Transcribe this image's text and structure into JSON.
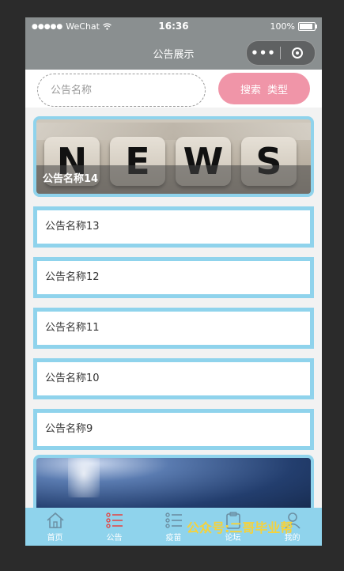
{
  "status": {
    "signal": "●●●●●",
    "carrier": "WeChat",
    "time": "16:36",
    "battery": "100%",
    "battery_level": 1.0
  },
  "navbar": {
    "title": "公告展示"
  },
  "search": {
    "placeholder": "公告名称",
    "value": "",
    "button_label_1": "搜索",
    "button_label_2": "类型"
  },
  "banner": {
    "caption": "公告名称14",
    "image_letters": [
      "N",
      "E",
      "W",
      "S"
    ]
  },
  "items": [
    {
      "label": "公告名称13"
    },
    {
      "label": "公告名称12"
    },
    {
      "label": "公告名称11"
    },
    {
      "label": "公告名称10"
    },
    {
      "label": "公告名称9"
    }
  ],
  "tabbar": [
    {
      "label": "首页",
      "icon": "home-icon"
    },
    {
      "label": "公告",
      "icon": "list-icon"
    },
    {
      "label": "疫苗",
      "icon": "list-icon"
    },
    {
      "label": "论坛",
      "icon": "clipboard-icon"
    },
    {
      "label": "我的",
      "icon": "user-icon"
    }
  ],
  "watermark": "公众号:二哥毕业帮",
  "colors": {
    "nav_bg": "#8a8f90",
    "accent_blue": "#8fd3ec",
    "search_button": "#f095a8",
    "active_tab": "#e04a4a",
    "watermark": "#f6d23a"
  }
}
